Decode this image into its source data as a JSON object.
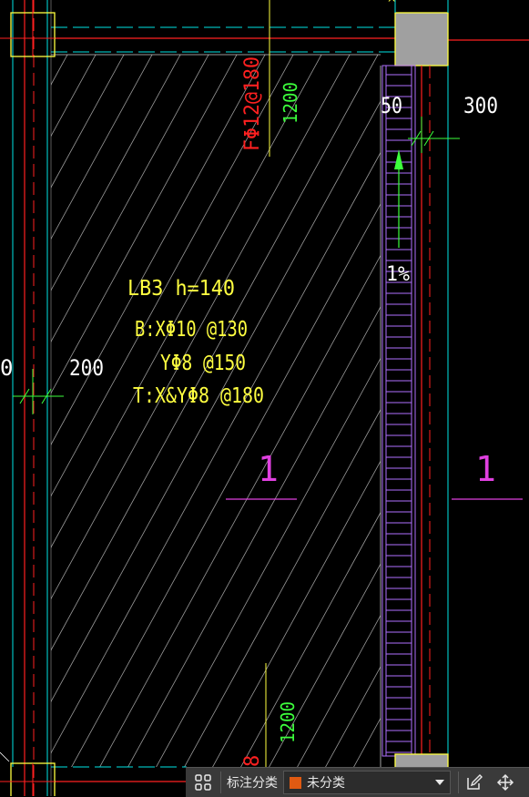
{
  "drawing": {
    "slab_label": "LB3  h=140",
    "bottom_rebar_x": "B:XΦ10 @130",
    "bottom_rebar_y": "YΦ8 @150",
    "top_rebar": "T:X&YΦ8 @180",
    "beam_rebar": "FΦ12@180",
    "dim_1200_top": "1200",
    "dim_1200_bottom": "1200",
    "dim_200": "200",
    "dim_left_partial": "0",
    "dim_50": "50",
    "dim_300": "300",
    "slope": "1%",
    "section_mark_left": "1",
    "section_mark_right": "1",
    "partial_bottom_text": "8"
  },
  "toolbar": {
    "annotation_category_label": "标注分类",
    "category_value": "未分类",
    "category_color": "#e05a12"
  },
  "colors": {
    "background": "#000000",
    "hatch": "#9a9a9a",
    "cyan": "#00e5e5",
    "red": "#ff2020",
    "yellow": "#ffff40",
    "green": "#3cff3c",
    "magenta": "#e040e0",
    "purple": "#b070ff",
    "gray_fill": "#a0a0a0"
  }
}
